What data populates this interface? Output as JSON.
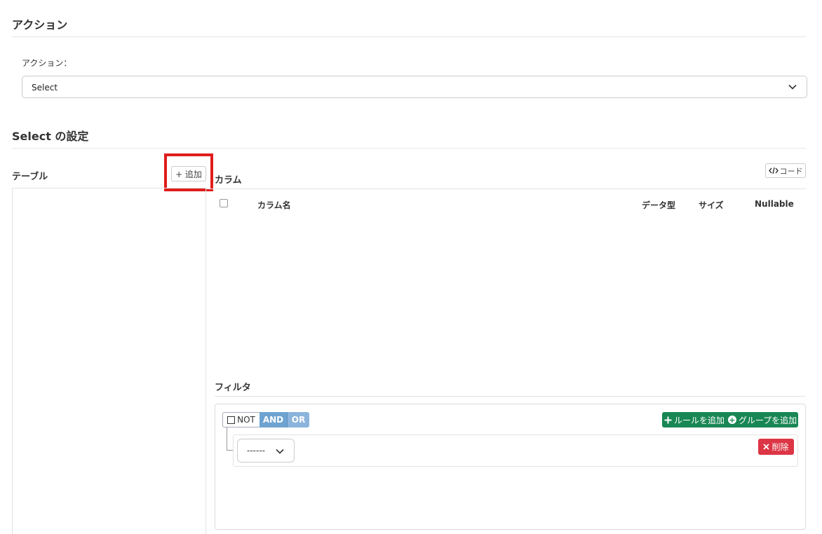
{
  "action_section": {
    "title": "アクション",
    "field_label": "アクション：",
    "selected": "Select"
  },
  "settings_section": {
    "title": "Select の設定"
  },
  "table_panel": {
    "label": "テーブル",
    "add_label": "+ 追加"
  },
  "columns_panel": {
    "label": "カラム",
    "code_label": "コード",
    "headers": [
      "カラム名",
      "データ型",
      "サイズ",
      "Nullable"
    ]
  },
  "filter_panel": {
    "label": "フィルタ",
    "not_label": "NOT",
    "and_label": "AND",
    "or_label": "OR",
    "add_rule_label": "ルールを追加",
    "add_group_label": "グループを追加",
    "rule_select_value": "------",
    "delete_label": "削除"
  },
  "colors": {
    "success": "#198754",
    "danger": "#dc3545",
    "and_active": "#6ea3d1",
    "highlight": "#e01c1c"
  }
}
